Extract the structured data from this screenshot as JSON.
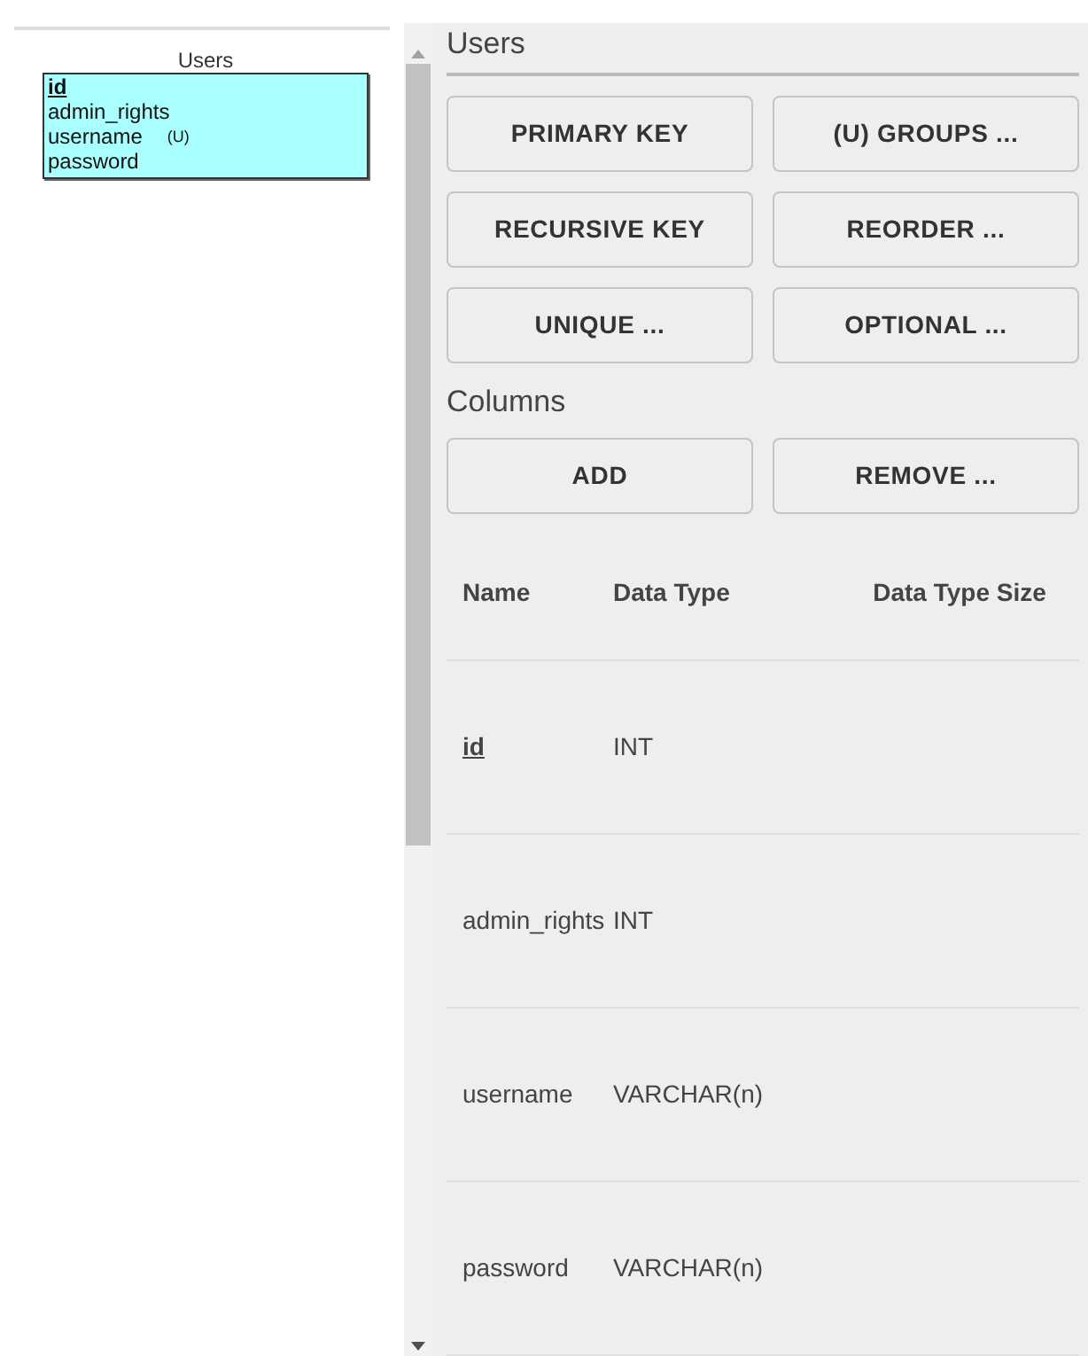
{
  "diagram": {
    "entity": {
      "title": "Users",
      "columns": [
        {
          "name": "id",
          "primary_key": true
        },
        {
          "name": "admin_rights",
          "primary_key": false
        },
        {
          "name": "username",
          "primary_key": false,
          "marker": "(U)"
        },
        {
          "name": "password",
          "primary_key": false
        }
      ]
    }
  },
  "panel": {
    "title": "Users",
    "table_buttons": [
      "PRIMARY KEY",
      "(U) GROUPS ...",
      "RECURSIVE KEY",
      "REORDER ...",
      "UNIQUE ...",
      "OPTIONAL ..."
    ],
    "columns_section": {
      "title": "Columns",
      "buttons": [
        "ADD",
        "REMOVE ..."
      ]
    },
    "table": {
      "columns": [
        "Name",
        "Data Type",
        "Data Type Size"
      ],
      "rows": [
        {
          "name": "id",
          "data_type": "INT",
          "primary_key": true
        },
        {
          "name": "admin_rights",
          "data_type": "INT",
          "primary_key": false
        },
        {
          "name": "username",
          "data_type": "VARCHAR(n)",
          "primary_key": false
        },
        {
          "name": "password",
          "data_type": "VARCHAR(n)",
          "primary_key": false
        }
      ]
    }
  }
}
